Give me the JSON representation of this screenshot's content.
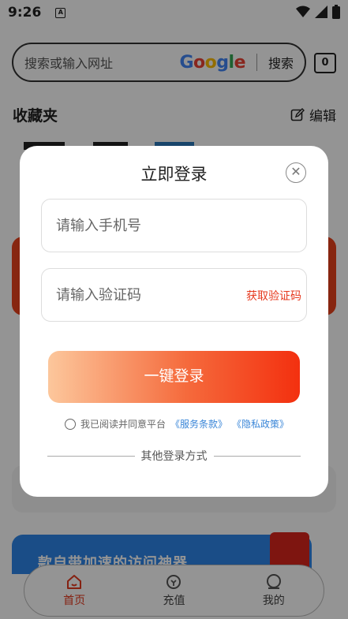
{
  "status_bar": {
    "time": "9:26",
    "notif_icon": "A"
  },
  "search": {
    "placeholder": "搜索或输入网址",
    "engine_logo": [
      "G",
      "o",
      "o",
      "g",
      "l",
      "e"
    ],
    "button_label": "搜索",
    "tab_count": "0"
  },
  "favorites": {
    "title": "收藏夹",
    "edit_label": "编辑"
  },
  "banner": {
    "text": "款自带加速的访问神器"
  },
  "bottom_nav": [
    {
      "label": "首页",
      "icon": "home-icon",
      "active": true
    },
    {
      "label": "充值",
      "icon": "recharge-icon",
      "active": false
    },
    {
      "label": "我的",
      "icon": "profile-icon",
      "active": false
    }
  ],
  "login_modal": {
    "title": "立即登录",
    "phone_placeholder": "请输入手机号",
    "code_placeholder": "请输入验证码",
    "get_code_label": "获取验证码",
    "login_button": "一键登录",
    "agree_text": "我已阅读并同意平台",
    "terms_link": "《服务条款》",
    "privacy_link": "《隐私政策》",
    "other_methods": "其他登录方式"
  },
  "colors": {
    "accent": "#e6391e",
    "link": "#3a86d8",
    "overlay": "rgba(0,0,0,0.42)"
  }
}
